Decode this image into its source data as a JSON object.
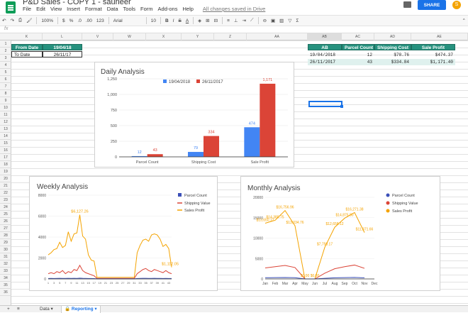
{
  "doc": {
    "title": "P&D Sales - COPY 1 - saurleer"
  },
  "menu": {
    "items": [
      "File",
      "Edit",
      "View",
      "Insert",
      "Format",
      "Data",
      "Tools",
      "Form",
      "Add-ons",
      "Help"
    ],
    "saved": "All changes saved in Drive"
  },
  "header": {
    "share_label": "SHARE",
    "avatar": "S"
  },
  "toolbar": {
    "zoom": "100%",
    "currency": "$",
    "percent": "%",
    "dec": ".0",
    "dec2": ".00",
    "fmt": "123",
    "font": "Arial",
    "size": "10"
  },
  "fx": {
    "label": "fx"
  },
  "columns": [
    "K",
    "L",
    "V",
    "W",
    "X",
    "Y",
    "Z",
    "AA",
    "AB",
    "AC",
    "AD",
    "AE"
  ],
  "rows": [
    "1",
    "2",
    "3",
    "4",
    "5",
    "6",
    "7",
    "8",
    "9",
    "10",
    "11",
    "12",
    "13",
    "14",
    "15",
    "16",
    "17",
    "18",
    "19",
    "20",
    "21",
    "22",
    "23",
    "24",
    "25",
    "26",
    "27",
    "28",
    "29",
    "30",
    "31",
    "32",
    "33",
    "34",
    "35",
    "36"
  ],
  "dates": {
    "from_label": "From Date",
    "from_value": "19/04/18",
    "to_label": "To Date",
    "to_value": "26/11/17"
  },
  "summary": {
    "headers": [
      "AB",
      "Parcel Count",
      "Shipping Cost",
      "Sale Profit"
    ],
    "rows": [
      [
        "19/04/2018",
        "12",
        "$78.76",
        "$474.37"
      ],
      [
        "26/11/2017",
        "43",
        "$334.84",
        "$1,171.40"
      ]
    ]
  },
  "daily": {
    "title": "Daily Analysis",
    "legend": [
      "19/04/2018",
      "26/11/2017"
    ],
    "colors": [
      "#4285f4",
      "#db4437"
    ],
    "categories": [
      "Parcel Count",
      "Shipping Cost",
      "Sale Profit"
    ],
    "y_ticks": [
      "0",
      "250",
      "500",
      "750",
      "1,000",
      "1,250"
    ],
    "labels_a": [
      "12",
      "79",
      "474"
    ],
    "labels_b": [
      "43",
      "334",
      "1,171"
    ]
  },
  "weekly": {
    "title": "Weekly Analysis",
    "legend": [
      "Parcel Count",
      "Shipping Value",
      "Sales Profit"
    ],
    "y_ticks": [
      "0",
      "2000",
      "4000",
      "6000",
      "8000"
    ],
    "peak_label": "$6,127.26",
    "end_label": "$1,112.05"
  },
  "monthly": {
    "title": "Monthly Analysis",
    "legend": [
      "Parcel Count",
      "Shipping Value",
      "Sales Profit"
    ],
    "y_ticks": [
      "0",
      "5000",
      "10000",
      "15000",
      "20000"
    ],
    "months": [
      "Jan",
      "Feb",
      "Mar",
      "Apr",
      "May",
      "Jun",
      "Jul",
      "Aug",
      "Sep",
      "Oct",
      "Nov",
      "Dec"
    ],
    "labels": [
      "$13,650.12",
      "$14,380.75",
      "$16,756.96",
      "$13,034.76",
      "$0.00",
      "$0.00",
      "$7,750.17",
      "$12,658.12",
      "$14,875.80",
      "$16,271.38",
      "$11,371.66"
    ]
  },
  "chart_data": [
    {
      "type": "bar",
      "title": "Daily Analysis",
      "categories": [
        "Parcel Count",
        "Shipping Cost",
        "Sale Profit"
      ],
      "series": [
        {
          "name": "19/04/2018",
          "values": [
            12,
            79,
            474
          ]
        },
        {
          "name": "26/11/2017",
          "values": [
            43,
            334,
            1171
          ]
        }
      ],
      "ylim": [
        0,
        1250
      ],
      "legend": "top"
    },
    {
      "type": "line",
      "title": "Weekly Analysis",
      "series": [
        {
          "name": "Sales Profit",
          "values": [
            2300,
            2500,
            2800,
            2900,
            3500,
            3000,
            3200,
            4500,
            3600,
            4300,
            4400,
            6127,
            4100,
            3800,
            2300,
            1800,
            1700,
            150,
            150,
            150,
            150,
            150,
            150,
            150,
            150,
            150,
            150,
            150,
            150,
            150,
            150,
            2500,
            3200,
            3700,
            3800,
            3600,
            4200,
            4300,
            4200,
            3800,
            3100,
            3300,
            2900,
            1112
          ]
        },
        {
          "name": "Shipping Value",
          "values": [
            500,
            600,
            500,
            700,
            600,
            800,
            500,
            700,
            600,
            900,
            800,
            1300,
            800,
            600,
            500,
            400,
            300,
            50,
            50,
            50,
            50,
            50,
            50,
            50,
            50,
            50,
            50,
            50,
            50,
            50,
            50,
            500,
            700,
            900,
            1000,
            800,
            700,
            900,
            800,
            700,
            600,
            800,
            600,
            500
          ]
        },
        {
          "name": "Parcel Count",
          "values": [
            40,
            50,
            45,
            50,
            60,
            55,
            50,
            60,
            55,
            60,
            50,
            80,
            60,
            50,
            40,
            40,
            30,
            5,
            5,
            5,
            5,
            5,
            5,
            5,
            5,
            5,
            5,
            5,
            5,
            5,
            5,
            40,
            50,
            60,
            60,
            55,
            50,
            60,
            55,
            50,
            45,
            50,
            45,
            40
          ]
        }
      ],
      "ylim": [
        0,
        8000
      ],
      "legend": "right"
    },
    {
      "type": "line",
      "title": "Monthly Analysis",
      "categories": [
        "Jan",
        "Feb",
        "Mar",
        "Apr",
        "May",
        "Jun",
        "Jul",
        "Aug",
        "Sep",
        "Oct",
        "Nov",
        "Dec"
      ],
      "series": [
        {
          "name": "Sales Profit",
          "values": [
            13650,
            14380,
            16757,
            13035,
            0,
            0,
            7750,
            12658,
            14876,
            16271,
            11372,
            null
          ]
        },
        {
          "name": "Shipping Value",
          "values": [
            2700,
            3000,
            3300,
            2800,
            0,
            0,
            1400,
            2500,
            3000,
            3400,
            2600,
            null
          ]
        },
        {
          "name": "Parcel Count",
          "values": [
            300,
            320,
            350,
            300,
            0,
            0,
            150,
            280,
            330,
            360,
            280,
            null
          ]
        }
      ],
      "ylim": [
        0,
        20000
      ],
      "legend": "right"
    }
  ]
}
